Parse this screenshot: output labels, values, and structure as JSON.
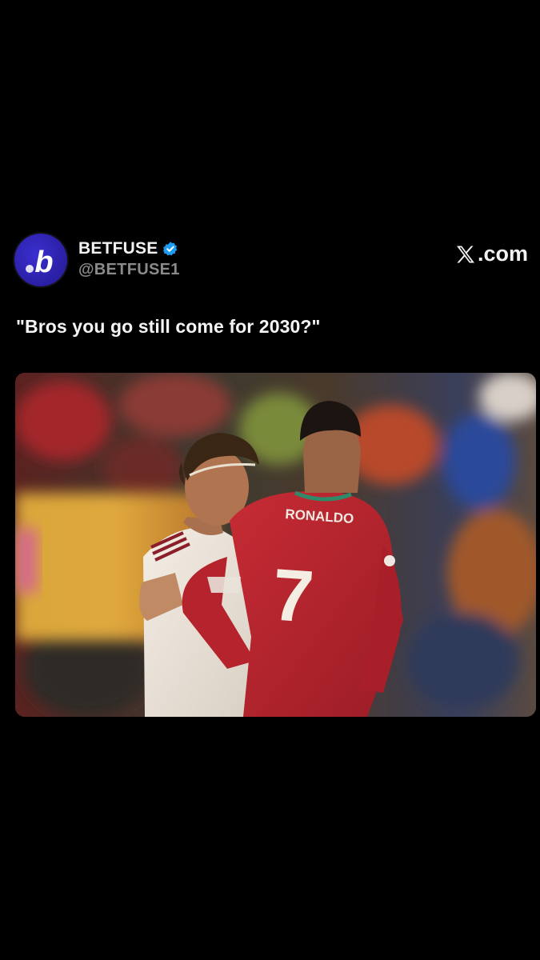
{
  "post": {
    "display_name": "BETFUSE",
    "handle": "@BETFUSE1",
    "avatar_letter": "b",
    "verified": true,
    "source_label": ".com",
    "text": "\"Bros you go still come for 2030?\""
  },
  "photo": {
    "jersey_name": "RONALDO",
    "jersey_number": "7"
  },
  "colors": {
    "background": "#000000",
    "avatar": "#2b1fb0",
    "verified_badge": "#1d9bf0",
    "handle_text": "#8a8a8a",
    "red_jersey": "#b8232e",
    "white_jersey": "#efe8e0"
  },
  "icons": {
    "avatar": "betfuse-logo-icon",
    "verified": "verified-badge-icon",
    "source": "x-logo-icon"
  }
}
